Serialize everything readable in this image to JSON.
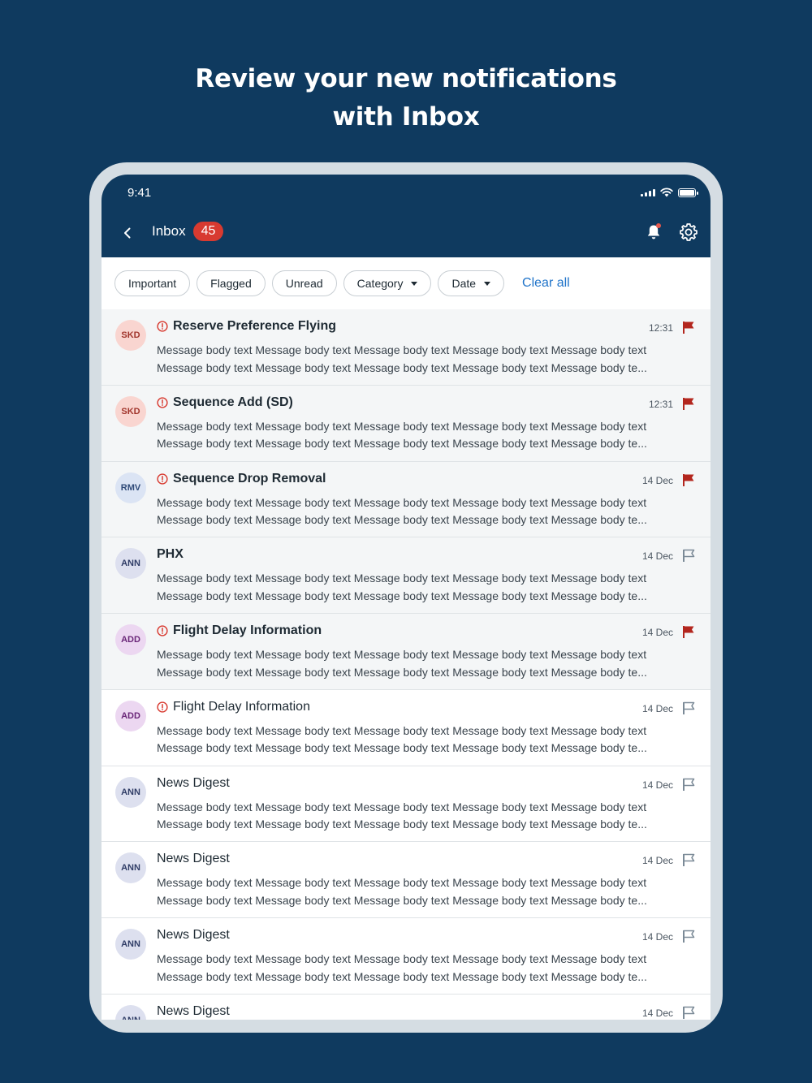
{
  "headline": {
    "line1": "Review your new notifications",
    "line2": "with Inbox"
  },
  "status_bar": {
    "time": "9:41"
  },
  "header": {
    "back_icon": "chevron-left-icon",
    "title": "Inbox",
    "badge_count": "45",
    "bell_icon": "bell-icon",
    "settings_icon": "gear-icon"
  },
  "filters": {
    "chips": [
      {
        "label": "Important"
      },
      {
        "label": "Flagged"
      },
      {
        "label": "Unread"
      },
      {
        "label": "Category",
        "has_dropdown": true
      },
      {
        "label": "Date",
        "has_dropdown": true
      }
    ],
    "clear_all": "Clear all"
  },
  "colors": {
    "navy": "#0f3a5f",
    "badge_red": "#d83a30",
    "flag_red": "#b3261e",
    "flag_outline": "#7b8a97",
    "link_blue": "#1f73c9",
    "avatar_skd_bg": "#f9d5d0",
    "avatar_skd_fg": "#a1352c",
    "avatar_rmv_bg": "#dbe4f4",
    "avatar_rmv_fg": "#2f4a78",
    "avatar_ann_bg": "#dde0ef",
    "avatar_ann_fg": "#2f3c66",
    "avatar_add_bg": "#ecd7f1",
    "avatar_add_fg": "#6a2678"
  },
  "messages": [
    {
      "avatar": "SKD",
      "title": "Reserve Preference Flying",
      "time": "12:31",
      "important": true,
      "bold": true,
      "flagged": true,
      "tinted": true,
      "body1": "Message body text Message body text Message body text Message body text Message body text",
      "body2": "Message body text Message body text Message body text Message body text Message body te..."
    },
    {
      "avatar": "SKD",
      "title": "Sequence Add (SD)",
      "time": "12:31",
      "important": true,
      "bold": true,
      "flagged": true,
      "tinted": true,
      "body1": "Message body text Message body text Message body text Message body text Message body text",
      "body2": "Message body text Message body text Message body text Message body text Message body te..."
    },
    {
      "avatar": "RMV",
      "title": "Sequence Drop Removal",
      "time": "14 Dec",
      "important": true,
      "bold": true,
      "flagged": true,
      "tinted": true,
      "body1": "Message body text Message body text Message body text Message body text Message body text",
      "body2": "Message body text Message body text Message body text Message body text Message body te..."
    },
    {
      "avatar": "ANN",
      "title": "PHX",
      "time": "14 Dec",
      "important": false,
      "bold": true,
      "flagged": false,
      "tinted": true,
      "body1": "Message body text Message body text Message body text Message body text Message body text",
      "body2": "Message body text Message body text Message body text Message body text Message body te..."
    },
    {
      "avatar": "ADD",
      "title": "Flight Delay Information",
      "time": "14 Dec",
      "important": true,
      "bold": true,
      "flagged": true,
      "tinted": true,
      "body1": "Message body text Message body text Message body text Message body text Message body text",
      "body2": "Message body text Message body text Message body text Message body text Message body te..."
    },
    {
      "avatar": "ADD",
      "title": "Flight Delay Information",
      "time": "14 Dec",
      "important": true,
      "bold": false,
      "flagged": false,
      "tinted": false,
      "body1": "Message body text Message body text Message body text Message body text Message body text",
      "body2": "Message body text Message body text Message body text Message body text Message body te..."
    },
    {
      "avatar": "ANN",
      "title": "News Digest",
      "time": "14 Dec",
      "important": false,
      "bold": false,
      "flagged": false,
      "tinted": false,
      "body1": "Message body text Message body text Message body text Message body text Message body text",
      "body2": "Message body text Message body text Message body text Message body text Message body te..."
    },
    {
      "avatar": "ANN",
      "title": "News Digest",
      "time": "14 Dec",
      "important": false,
      "bold": false,
      "flagged": false,
      "tinted": false,
      "body1": "Message body text Message body text Message body text Message body text Message body text",
      "body2": "Message body text Message body text Message body text Message body text Message body te..."
    },
    {
      "avatar": "ANN",
      "title": "News Digest",
      "time": "14 Dec",
      "important": false,
      "bold": false,
      "flagged": false,
      "tinted": false,
      "body1": "Message body text Message body text Message body text Message body text Message body text",
      "body2": "Message body text Message body text Message body text Message body text Message body te..."
    },
    {
      "avatar": "ANN",
      "title": "News Digest",
      "time": "14 Dec",
      "important": false,
      "bold": false,
      "flagged": false,
      "tinted": false,
      "body1": "",
      "body2": ""
    }
  ]
}
